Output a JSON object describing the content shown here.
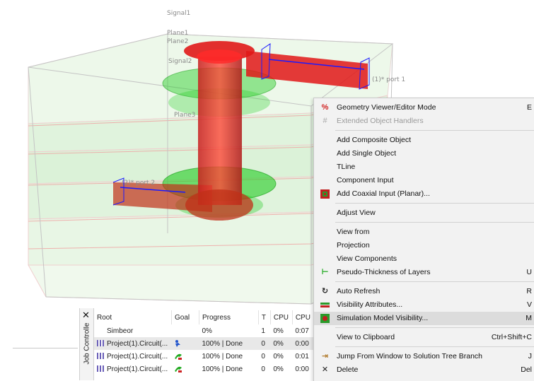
{
  "viewport": {
    "labels": {
      "signal1": "Signal1",
      "plane1": "Plane1",
      "plane2": "Plane2",
      "signal2": "Signal2",
      "plane3": "Plane3",
      "port1": "(1)* port 1",
      "port2": "(2)* port 2"
    }
  },
  "job_controller": {
    "title": "Job Controlle",
    "close_glyph": "✕",
    "columns": [
      "Root",
      "Goal",
      "Progress",
      "T",
      "CPU",
      "CPU"
    ],
    "rows": [
      {
        "root": "Simbeor",
        "goal": "",
        "progress": "0%",
        "t": "1",
        "cpu": "0%",
        "cpu2": "0:07"
      },
      {
        "root": "Project(1).Circuit(...",
        "goal": "run",
        "progress": "100% | Done",
        "t": "0",
        "cpu": "0%",
        "cpu2": "0:00"
      },
      {
        "root": "Project(1).Circuit(...",
        "goal": "sim",
        "progress": "100% | Done",
        "t": "0",
        "cpu": "0%",
        "cpu2": "0:01"
      },
      {
        "root": "Project(1).Circuit(...",
        "goal": "sim",
        "progress": "100% | Done",
        "t": "0",
        "cpu": "0%",
        "cpu2": "0:00"
      }
    ]
  },
  "context_menu": {
    "items": [
      {
        "label": "Geometry Viewer/Editor Mode",
        "shortcut": "E",
        "icon": "geometry-mode-icon"
      },
      {
        "label": "Extended Object Handlers",
        "shortcut": "",
        "icon": "grid-handlers-icon"
      },
      {
        "label": "Add Composite Object",
        "shortcut": "",
        "icon": ""
      },
      {
        "label": "Add Single Object",
        "shortcut": "",
        "icon": ""
      },
      {
        "label": "TLine",
        "shortcut": "",
        "icon": ""
      },
      {
        "label": "Component Input",
        "shortcut": "",
        "icon": ""
      },
      {
        "label": "Add Coaxial Input (Planar)...",
        "shortcut": "",
        "icon": "coaxial-input-icon"
      },
      {
        "label": "Adjust View",
        "shortcut": "",
        "icon": ""
      },
      {
        "label": "View from",
        "shortcut": "",
        "icon": ""
      },
      {
        "label": "Projection",
        "shortcut": "",
        "icon": ""
      },
      {
        "label": "View Components",
        "shortcut": "",
        "icon": ""
      },
      {
        "label": "Pseudo-Thickness of Layers",
        "shortcut": "U",
        "icon": "thickness-icon"
      },
      {
        "label": "Auto Refresh",
        "shortcut": "R",
        "icon": "refresh-icon"
      },
      {
        "label": "Visibility Attributes...",
        "shortcut": "V",
        "icon": "visibility-icon"
      },
      {
        "label": "Simulation Model Visibility...",
        "shortcut": "M",
        "icon": "sim-visibility-icon"
      },
      {
        "label": "View to Clipboard",
        "shortcut": "Ctrl+Shift+C",
        "icon": ""
      },
      {
        "label": "Jump From Window to Solution Tree Branch",
        "shortcut": "J",
        "icon": "jump-icon"
      },
      {
        "label": "Delete",
        "shortcut": "Del",
        "icon": "delete-icon"
      }
    ]
  },
  "colors": {
    "trace_red": "#e01818",
    "pad_green": "#22cc22",
    "plane_green": "#b9e6b4",
    "box_edge": "#c4c4c4",
    "port_blue": "#1a1aff",
    "menu_bg": "#f2f2f2",
    "menu_highlight": "#dcdcdc"
  }
}
